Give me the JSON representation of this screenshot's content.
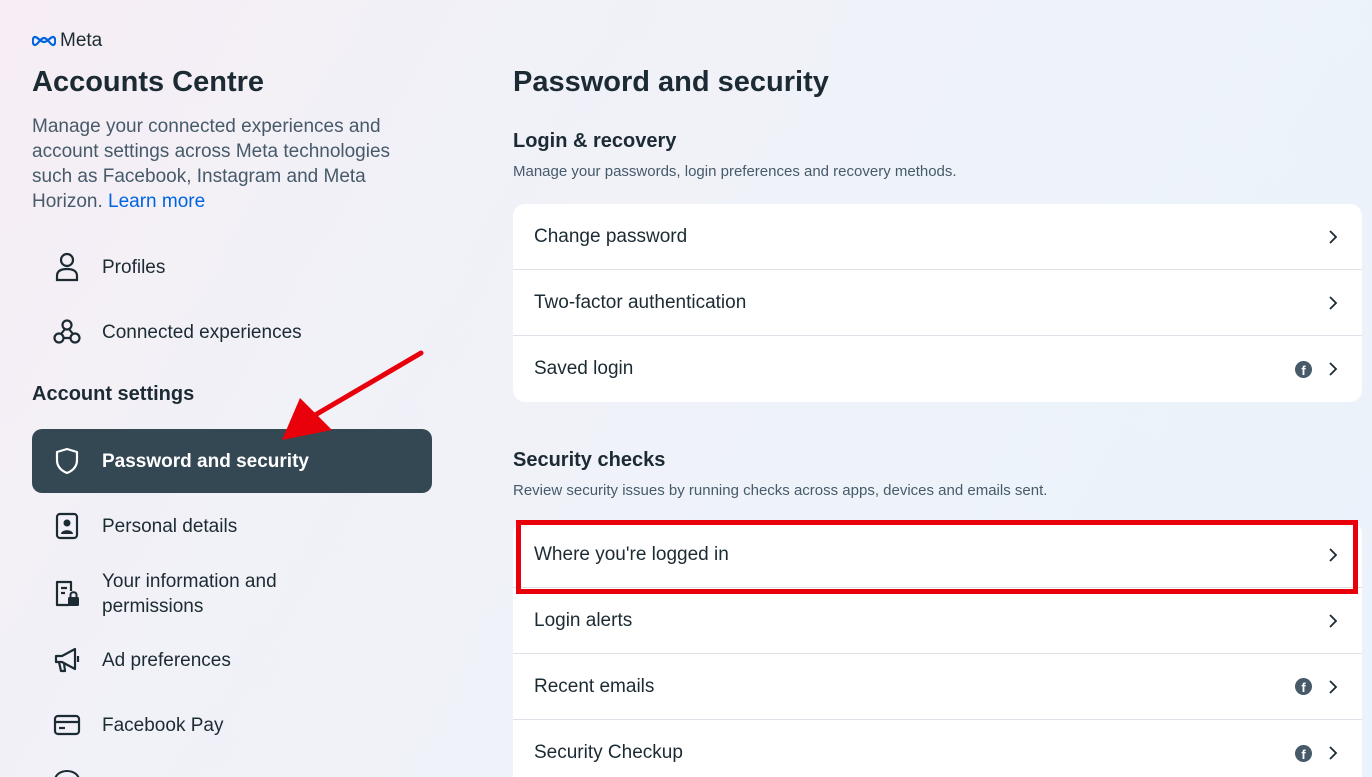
{
  "sidebar": {
    "brand": "Meta",
    "title": "Accounts Centre",
    "description": "Manage your connected experiences and account settings across Meta technologies such as Facebook, Instagram and Meta Horizon.",
    "learn_more": "Learn more",
    "top_items": [
      {
        "label": "Profiles",
        "icon": "person-icon"
      },
      {
        "label": "Connected experiences",
        "icon": "connected-icon"
      }
    ],
    "section_title": "Account settings",
    "settings_items": [
      {
        "label": "Password and security",
        "icon": "shield-icon",
        "active": true
      },
      {
        "label": "Personal details",
        "icon": "id-card-icon"
      },
      {
        "label": "Your information and permissions",
        "icon": "document-lock-icon"
      },
      {
        "label": "Ad preferences",
        "icon": "megaphone-icon"
      },
      {
        "label": "Facebook Pay",
        "icon": "card-icon"
      }
    ]
  },
  "main": {
    "title": "Password and security",
    "login_recovery": {
      "title": "Login & recovery",
      "description": "Manage your passwords, login preferences and recovery methods.",
      "rows": [
        {
          "label": "Change password",
          "facebook": false
        },
        {
          "label": "Two-factor authentication",
          "facebook": false
        },
        {
          "label": "Saved login",
          "facebook": true
        }
      ]
    },
    "security_checks": {
      "title": "Security checks",
      "description": "Review security issues by running checks across apps, devices and emails sent.",
      "rows": [
        {
          "label": "Where you're logged in",
          "facebook": false,
          "highlighted": true
        },
        {
          "label": "Login alerts",
          "facebook": false
        },
        {
          "label": "Recent emails",
          "facebook": true
        },
        {
          "label": "Security Checkup",
          "facebook": true
        }
      ]
    }
  },
  "colors": {
    "active_nav_bg": "#344854",
    "link": "#0064e0",
    "highlight_box": "#e8000b",
    "arrow": "#e8000b"
  }
}
